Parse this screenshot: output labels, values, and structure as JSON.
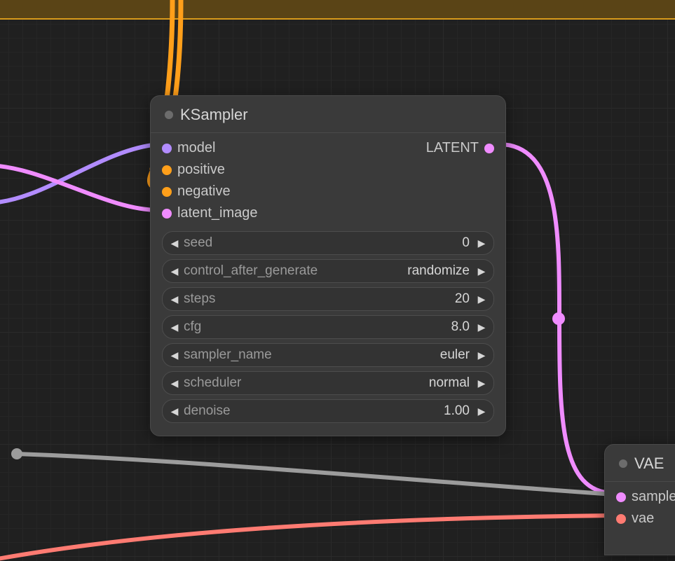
{
  "node1": {
    "title": "KSampler",
    "inputs": {
      "model": "model",
      "positive": "positive",
      "negative": "negative",
      "latent_image": "latent_image"
    },
    "outputs": {
      "latent": "LATENT"
    },
    "params": {
      "seed": {
        "label": "seed",
        "value": "0"
      },
      "control": {
        "label": "control_after_generate",
        "value": "randomize"
      },
      "steps": {
        "label": "steps",
        "value": "20"
      },
      "cfg": {
        "label": "cfg",
        "value": "8.0"
      },
      "sampler_name": {
        "label": "sampler_name",
        "value": "euler"
      },
      "scheduler": {
        "label": "scheduler",
        "value": "normal"
      },
      "denoise": {
        "label": "denoise",
        "value": "1.00"
      }
    }
  },
  "node2": {
    "title_partial": "VAE ",
    "inputs": {
      "samples": "samples",
      "vae": "vae"
    }
  },
  "colors": {
    "purple": "#b28cff",
    "orange": "#ff9f1a",
    "pink": "#f08cff",
    "salmon": "#ff7b72",
    "grey": "#9c9c9c"
  }
}
